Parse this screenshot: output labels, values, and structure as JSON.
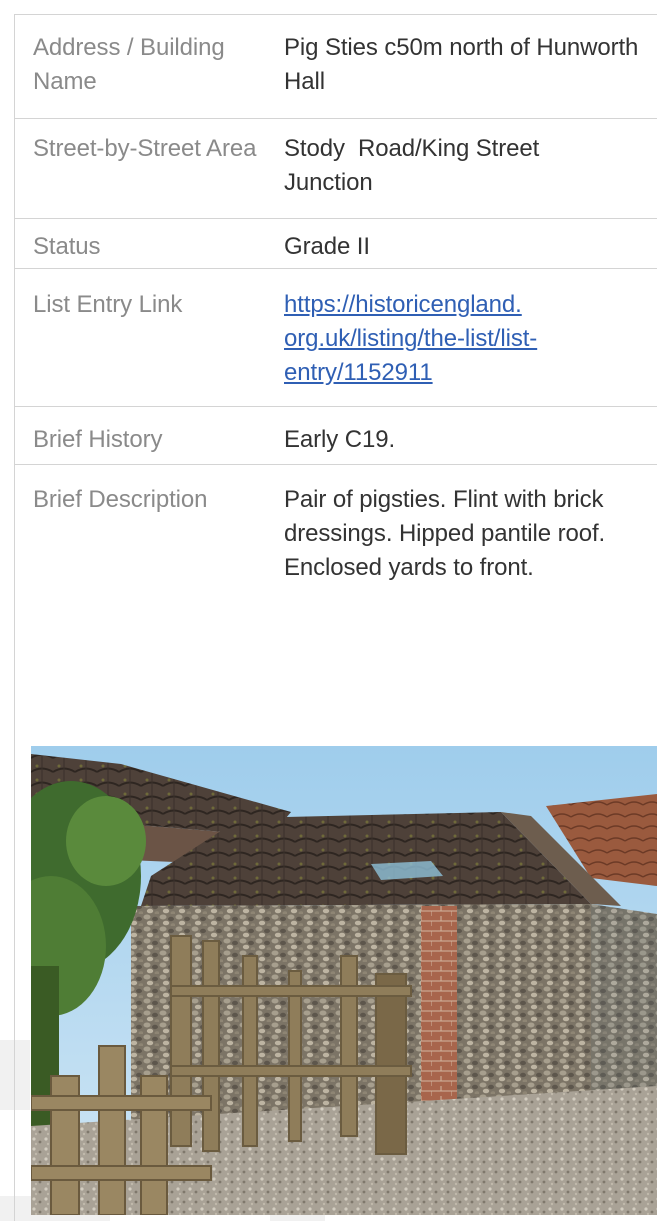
{
  "table": {
    "rows": [
      {
        "label": "Address / Building Name",
        "value": "Pig Sties c50m north of Hunworth Hall"
      },
      {
        "label": "Street-by-Street Area",
        "value": "Stody  Road/King Street Junction"
      },
      {
        "label": "Status",
        "value": "Grade II"
      },
      {
        "label": "List Entry Link",
        "value": "https://historicengland.org.uk/listing/the-list/list-entry/1152911",
        "value_lines": [
          "https://historicengland.",
          "org.uk/listing/the-list/list-",
          "entry/1152911"
        ]
      },
      {
        "label": "Brief History",
        "value": "Early C19."
      },
      {
        "label": "Brief Description",
        "value": "Pair of pigsties. Flint with brick dressings. Hipped pantile roof. Enclosed yards to front."
      }
    ]
  },
  "colors": {
    "label_text": "#8a8a8a",
    "value_text": "#333333",
    "link": "#2f5fb4",
    "rule": "#d4d4d4"
  },
  "photo": {
    "subject": "flint-and-brick-pigsties-with-pantile-roof-and-wooden-gate"
  }
}
